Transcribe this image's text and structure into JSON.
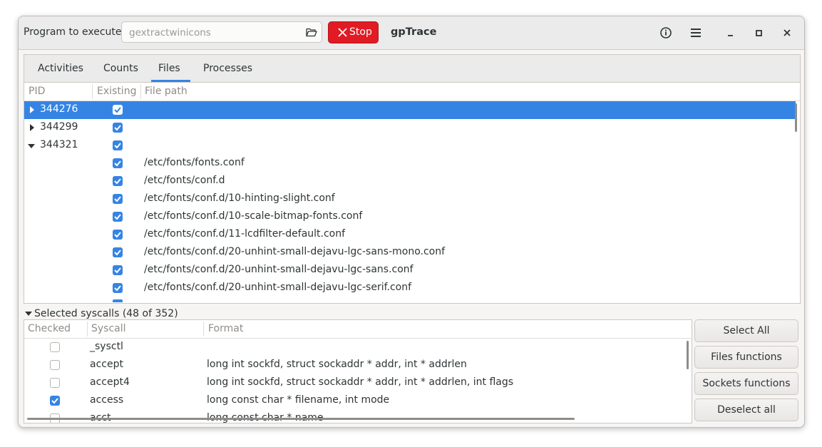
{
  "header": {
    "program_label": "Program to execute:",
    "program_placeholder": "gextractwinicons",
    "stop_label": "Stop",
    "app_title": "gpTrace"
  },
  "tabs": [
    {
      "label": "Activities",
      "active": false
    },
    {
      "label": "Counts",
      "active": false
    },
    {
      "label": "Files",
      "active": true
    },
    {
      "label": "Processes",
      "active": false
    }
  ],
  "files_table": {
    "columns": [
      "PID",
      "Existing",
      "File path"
    ],
    "rows": [
      {
        "pid": "344276",
        "expanded": false,
        "existing": true,
        "path": "",
        "selected": true
      },
      {
        "pid": "344299",
        "expanded": false,
        "existing": true,
        "path": ""
      },
      {
        "pid": "344321",
        "expanded": true,
        "existing": true,
        "path": ""
      },
      {
        "pid": "",
        "existing": true,
        "path": "/etc/fonts/fonts.conf"
      },
      {
        "pid": "",
        "existing": true,
        "path": "/etc/fonts/conf.d"
      },
      {
        "pid": "",
        "existing": true,
        "path": "/etc/fonts/conf.d/10-hinting-slight.conf"
      },
      {
        "pid": "",
        "existing": true,
        "path": "/etc/fonts/conf.d/10-scale-bitmap-fonts.conf"
      },
      {
        "pid": "",
        "existing": true,
        "path": "/etc/fonts/conf.d/11-lcdfilter-default.conf"
      },
      {
        "pid": "",
        "existing": true,
        "path": "/etc/fonts/conf.d/20-unhint-small-dejavu-lgc-sans-mono.conf"
      },
      {
        "pid": "",
        "existing": true,
        "path": "/etc/fonts/conf.d/20-unhint-small-dejavu-lgc-sans.conf"
      },
      {
        "pid": "",
        "existing": true,
        "path": "/etc/fonts/conf.d/20-unhint-small-dejavu-lgc-serif.conf"
      }
    ]
  },
  "syscalls": {
    "expander_label": "Selected syscalls (48 of 352)",
    "columns": [
      "Checked",
      "Syscall",
      "Format"
    ],
    "rows": [
      {
        "checked": false,
        "name": "_sysctl",
        "format": ""
      },
      {
        "checked": false,
        "name": "accept",
        "format": "long int sockfd, struct sockaddr * addr, int * addrlen"
      },
      {
        "checked": false,
        "name": "accept4",
        "format": "long int sockfd, struct sockaddr * addr, int * addrlen, int flags"
      },
      {
        "checked": true,
        "name": "access",
        "format": "long const char * filename, int mode"
      },
      {
        "checked": false,
        "name": "acct",
        "format": "long const char * name"
      }
    ]
  },
  "side_buttons": {
    "select_all": "Select All",
    "files_functions": "Files functions",
    "sockets_functions": "Sockets functions",
    "deselect_all": "Deselect all"
  },
  "colors": {
    "accent": "#3584e4",
    "stop": "#e01b24"
  },
  "icons": [
    "folder-open-icon",
    "close-x-icon",
    "info-icon",
    "hamburger-menu-icon",
    "minimize-icon",
    "maximize-icon",
    "close-window-icon",
    "expander-arrow-icon",
    "checkbox-icon"
  ]
}
